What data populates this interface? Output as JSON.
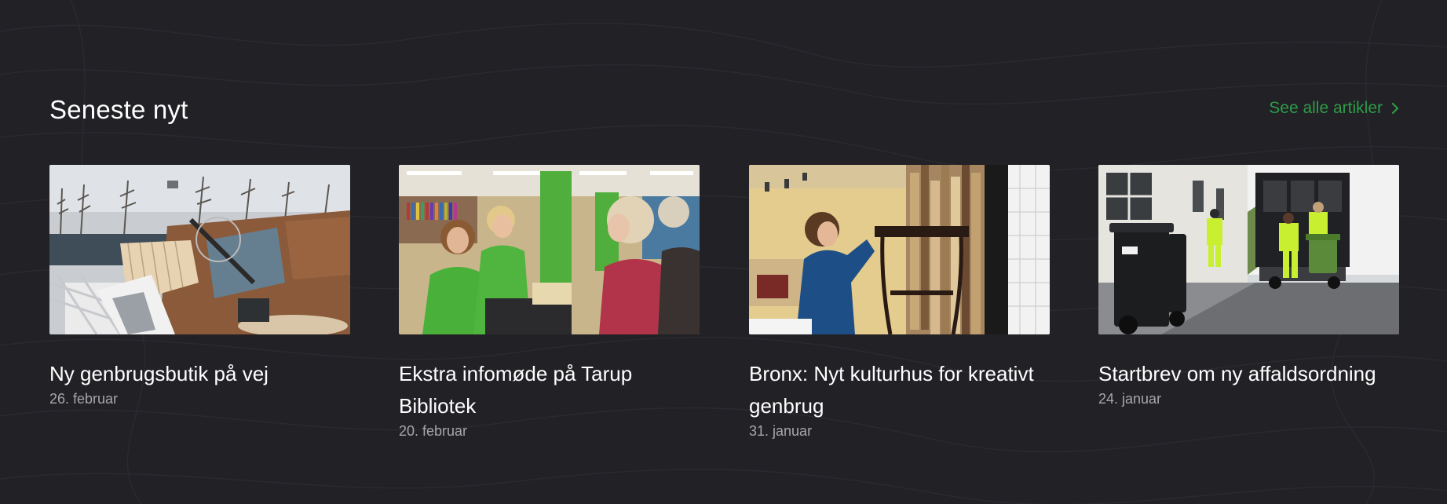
{
  "section": {
    "title": "Seneste nyt",
    "see_all_label": "See alle artikler",
    "see_all_icon": "chevron-right-icon",
    "accent_color": "#2e9b47",
    "background_color": "#222126"
  },
  "articles": [
    {
      "title": "Ny genbrugsbutik på vej",
      "date": "26. februar",
      "image": "recycling-container-photo"
    },
    {
      "title": "Ekstra infomøde på Tarup Bibliotek",
      "date": "20. februar",
      "image": "library-info-meeting-photo"
    },
    {
      "title": "Bronx: Nyt kulturhus for kreativt genbrug",
      "date": "31. januar",
      "image": "culture-house-photo"
    },
    {
      "title": "Startbrev om ny affaldsordning",
      "date": "24. januar",
      "image": "waste-bins-street-photo"
    }
  ]
}
